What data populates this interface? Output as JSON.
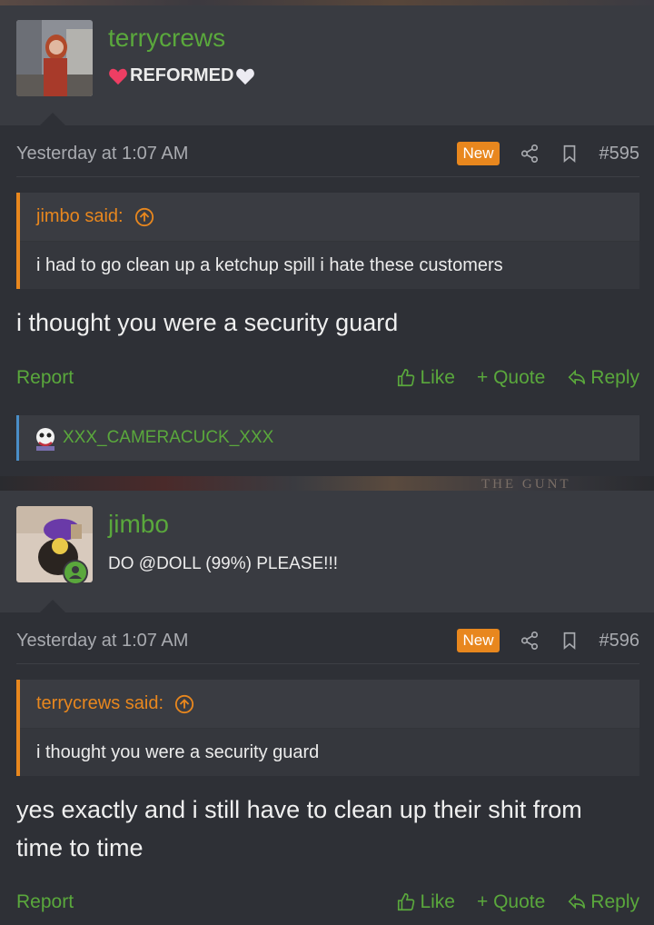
{
  "posts": [
    {
      "username": "terrycrews",
      "user_title": "REFORMED",
      "date": "Yesterday at 1:07 AM",
      "new_badge": "New",
      "post_number": "#595",
      "quote": {
        "author": "jimbo said:",
        "text": "i had to go clean up a ketchup spill i hate these customers"
      },
      "message": "i thought you were a security guard",
      "report": "Report",
      "like": "Like",
      "quote_action": "+ Quote",
      "reply": "Reply",
      "liked_by": "XXX_CAMERACUCK_XXX"
    },
    {
      "username": "jimbo",
      "user_title": "DO @DOLL (99%) PLEASE!!!",
      "date": "Yesterday at 1:07 AM",
      "new_badge": "New",
      "post_number": "#596",
      "quote": {
        "author": "terrycrews said:",
        "text": "i thought you were a security guard"
      },
      "message": "yes exactly and i still have to clean up their shit from time to time",
      "report": "Report",
      "like": "Like",
      "quote_action": "+ Quote",
      "reply": "Reply"
    }
  ],
  "colors": {
    "accent_green": "#5aa83c",
    "accent_orange": "#e8871e",
    "background": "#2e3036"
  },
  "icons": [
    "share-icon",
    "bookmark-icon",
    "up-arrow-circle-icon",
    "thumbs-up-icon",
    "reply-icon",
    "heart-icon",
    "online-status-icon"
  ]
}
